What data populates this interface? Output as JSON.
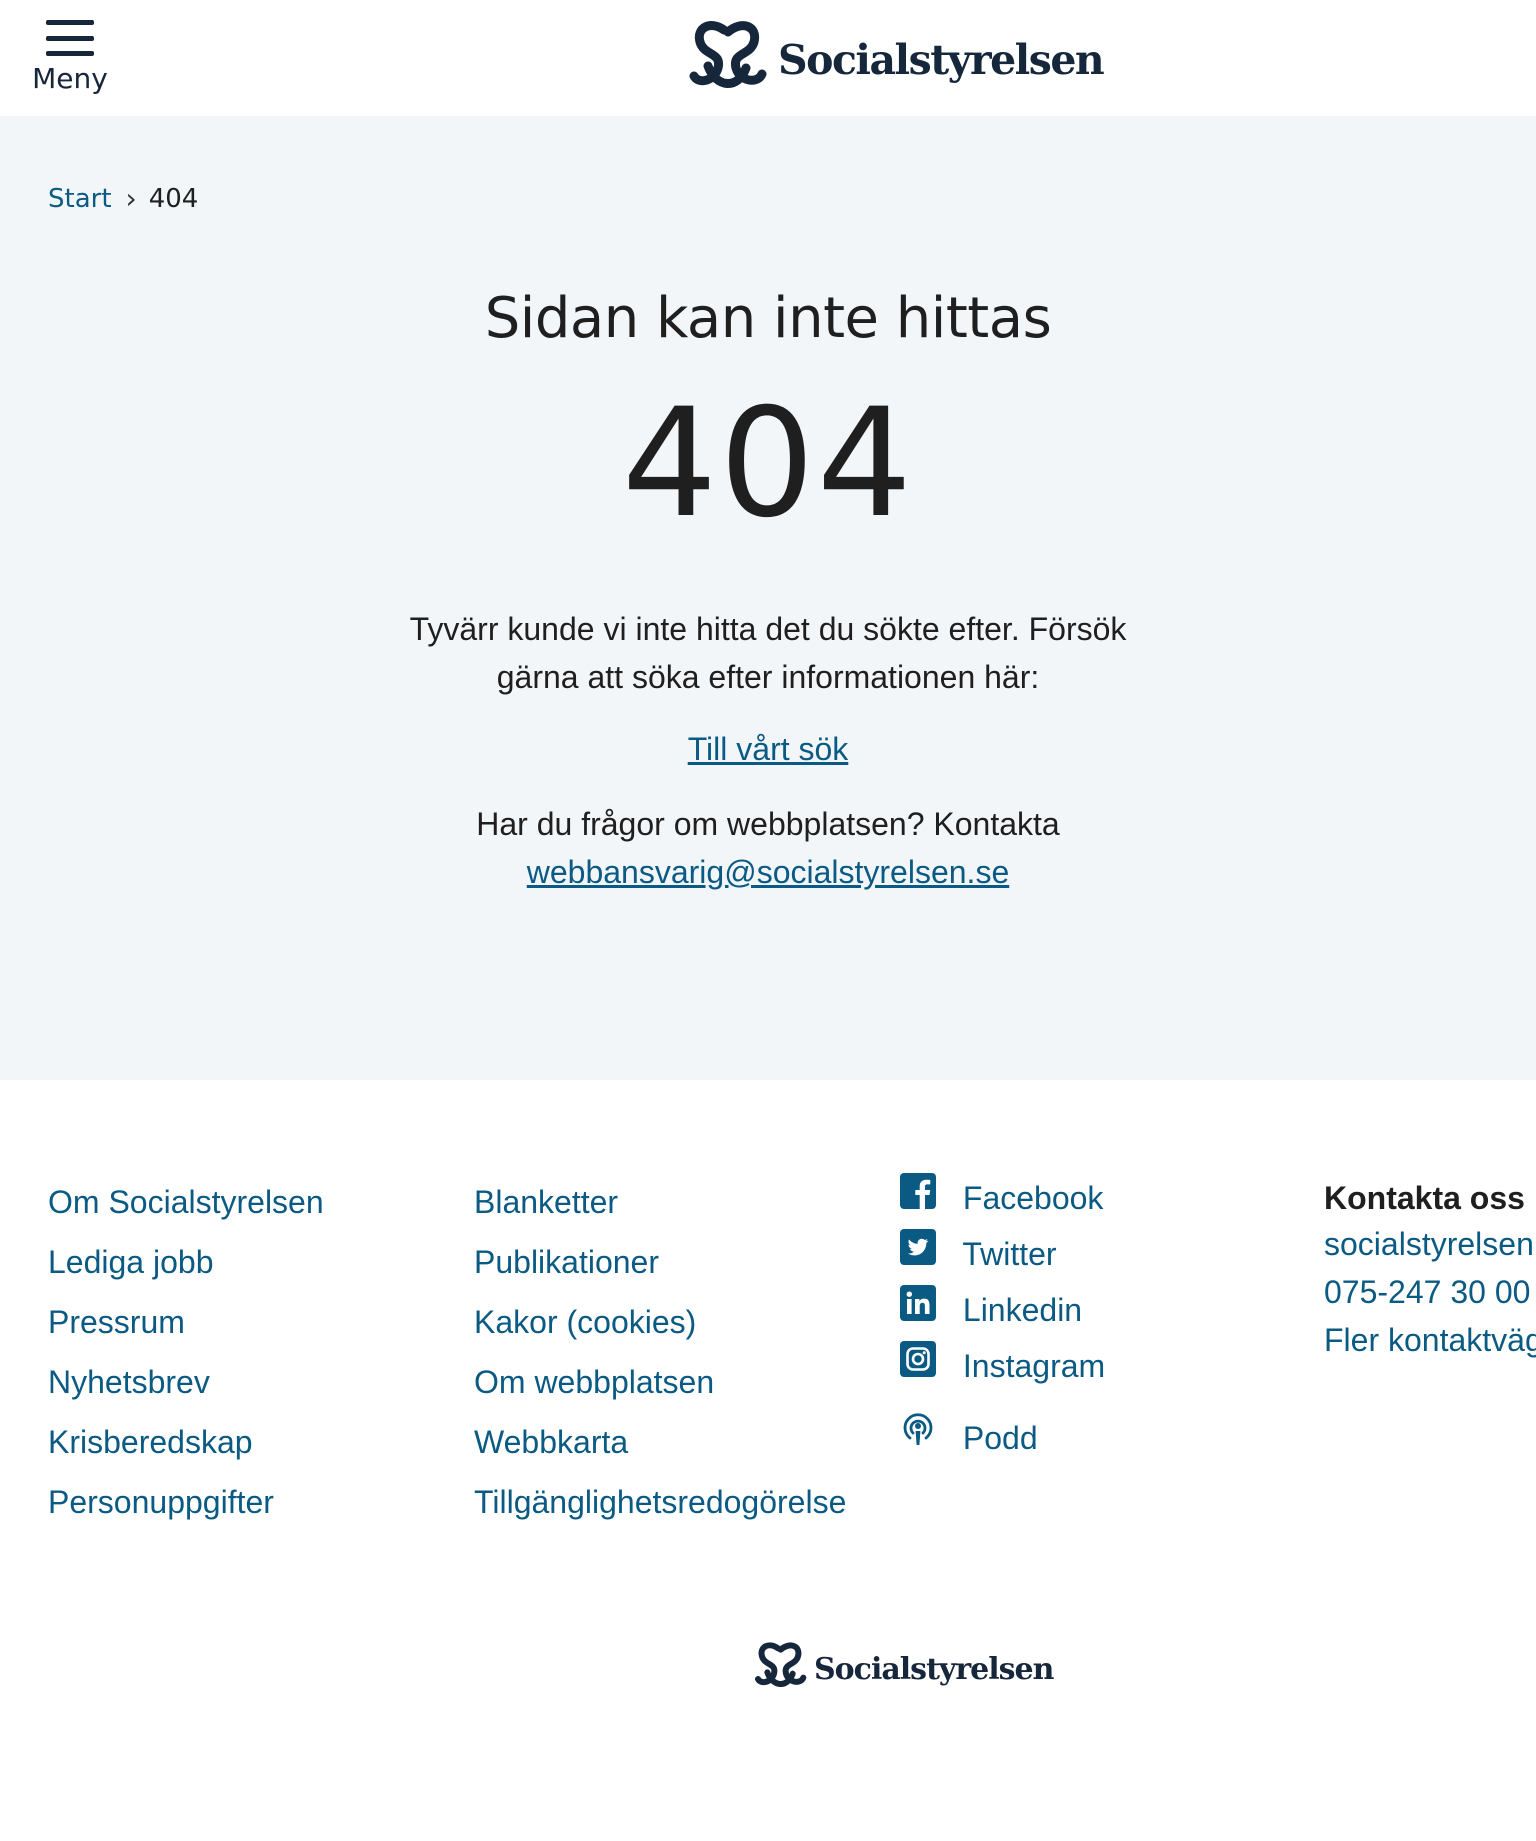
{
  "header": {
    "menu_label": "Meny",
    "logo_text": "Socialstyrelsen"
  },
  "breadcrumb": {
    "start": "Start",
    "current": "404"
  },
  "main": {
    "title": "Sidan kan inte hittas",
    "error_code": "404",
    "info_text": "Tyvärr kunde vi inte hitta det du sökte efter. Försök gärna att söka efter informationen här:",
    "search_link": "Till vårt sök",
    "contact_prefix": "Har du frågor om webbplatsen? Kontakta",
    "contact_email": "webbansvarig@socialstyrelsen.se"
  },
  "footer": {
    "col1": [
      "Om Socialstyrelsen",
      "Lediga jobb",
      "Pressrum",
      "Nyhetsbrev",
      "Krisberedskap",
      "Personuppgifter"
    ],
    "col2": [
      "Blanketter",
      "Publikationer",
      "Kakor (cookies)",
      "Om webbplatsen",
      "Webbkarta",
      "Tillgänglighetsredogörelse"
    ],
    "social": [
      {
        "label": "Facebook",
        "icon": "facebook-icon"
      },
      {
        "label": "Twitter",
        "icon": "twitter-icon"
      },
      {
        "label": "Linkedin",
        "icon": "linkedin-icon"
      },
      {
        "label": "Instagram",
        "icon": "instagram-icon"
      },
      {
        "label": "Podd",
        "icon": "podcast-icon"
      }
    ],
    "contact": {
      "heading": "Kontakta oss",
      "email": "socialstyrelsen",
      "phone": "075-247 30 00",
      "more": "Fler kontaktväg"
    },
    "logo_text": "Socialstyrelsen"
  },
  "colors": {
    "brand_dark": "#16263b",
    "link": "#0b5a84",
    "main_bg": "#f2f6f9"
  }
}
